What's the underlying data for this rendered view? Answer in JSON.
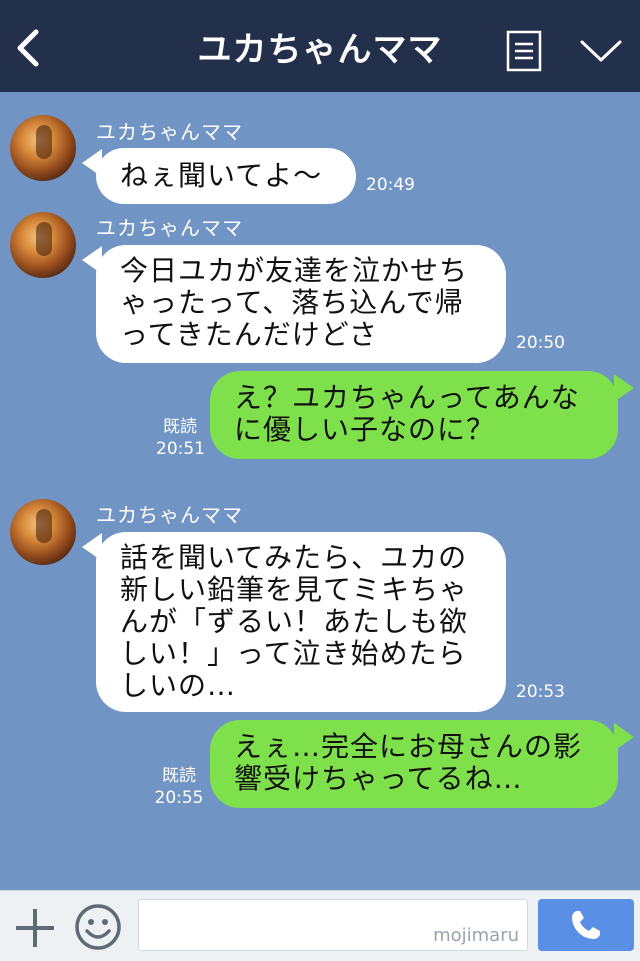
{
  "header": {
    "title": "ユカちゃんママ",
    "back_icon": "chevron-left-icon",
    "menu_icon": "list-icon",
    "dropdown_icon": "chevron-down-icon"
  },
  "messages": [
    {
      "from": "other",
      "sender": "ユカちゃんママ",
      "text": "ねぇ聞いてよ〜",
      "time": "20:49"
    },
    {
      "from": "other",
      "sender": "ユカちゃんママ",
      "text": "今日ユカが友達を泣かせち\nゃったって、落ち込んで帰\nってきたんだけどさ",
      "time": "20:50"
    },
    {
      "from": "me",
      "text": "え？ユカちゃんってあんな\nに優しい子なのに？",
      "read": "既読",
      "time": "20:51"
    },
    {
      "from": "other",
      "sender": "ユカちゃんママ",
      "text": "話を聞いてみたら、ユカの\n新しい鉛筆を見てミキちゃ\nんが「ずるい！あたしも欲\nしい！」って泣き始めたら\nしいの…",
      "time": "20:53"
    },
    {
      "from": "me",
      "text": "えぇ…完全にお母さんの影\n響受けちゃってるね…",
      "read": "既読",
      "time": "20:55"
    }
  ],
  "footer": {
    "plus_icon": "plus-icon",
    "emoji_icon": "smiley-icon",
    "input_value": "",
    "watermark": "mojimaru",
    "call_icon": "phone-icon"
  },
  "colors": {
    "header_bg": "#22304b",
    "chat_bg": "#7094c4",
    "incoming_bubble": "#ffffff",
    "outgoing_bubble": "#7ee14c",
    "call_button": "#5a8fe6"
  }
}
